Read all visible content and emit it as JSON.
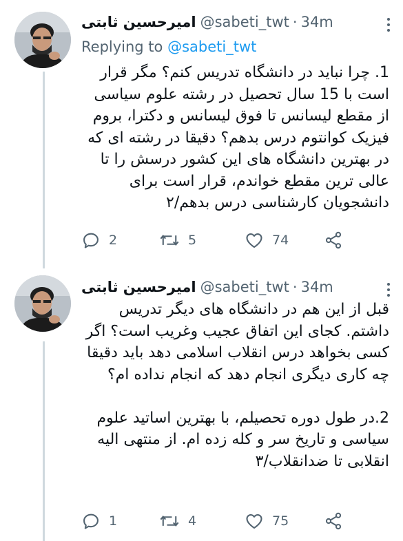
{
  "tweets": [
    {
      "author_name": "امیرحسین ثابتی",
      "handle": "@sabeti_twt",
      "separator": "·",
      "time": "34m",
      "replying_prefix": "Replying to",
      "replying_to": "@sabeti_twt",
      "text": "1. چرا نباید در دانشگاه تدریس کنم؟ مگر قرار است با 15 سال تحصیل در رشته علوم سیاسی از مقطع لیسانس تا فوق لیسانس و دکترا، بروم فیزیک کوانتوم درس بدهم؟ دقیقا در رشته ای که در بهترین دانشگاه های این کشور درسش را تا عالی ترین مقطع خواندم، قرار است برای دانشجویان کارشناسی درس بدهم/۲",
      "replies": "2",
      "retweets": "5",
      "likes": "74"
    },
    {
      "author_name": "امیرحسین ثابتی",
      "handle": "@sabeti_twt",
      "separator": "·",
      "time": "34m",
      "text": "قبل از این هم در دانشگاه های دیگر تدریس داشتم. کجای این اتفاق عجیب وغریب است؟ اگر کسی بخواهد درس انقلاب اسلامی دهد باید دقیقا چه کاری دیگری انجام دهد که انجام نداده ام؟\n\n2.در طول دوره تحصیلم، با بهترین اساتید علوم سیاسی و تاریخ سر و کله زده ام. از منتهی الیه انقلابی تا ضدانقلاب/۳",
      "replies": "1",
      "retweets": "4",
      "likes": "75"
    }
  ],
  "colors": {
    "text": "#0f1419",
    "secondary": "#536471",
    "link": "#1d9bf0",
    "thread_line": "#cfd9de"
  },
  "icons": [
    "reply-icon",
    "retweet-icon",
    "like-icon",
    "share-icon",
    "more-icon"
  ]
}
